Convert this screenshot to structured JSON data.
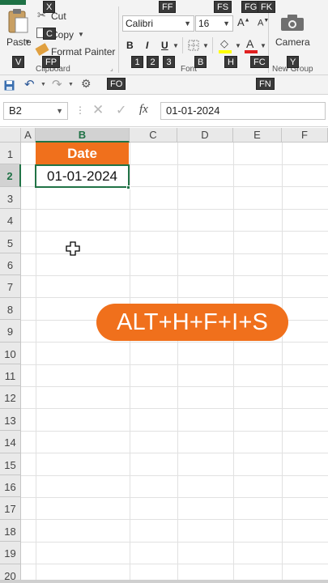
{
  "ribbon": {
    "clipboard": {
      "paste_label": "Paste",
      "cut_label": "Cut",
      "copy_label": "Copy",
      "format_painter_label": "Format Painter",
      "group_label": "Clipboard"
    },
    "font": {
      "font_name": "Calibri",
      "font_size": "16",
      "bold": "B",
      "italic": "I",
      "underline": "U",
      "group_label": "Font"
    },
    "new_group": {
      "camera_label": "Camera",
      "group_label": "New Group"
    },
    "keytips": {
      "x": "X",
      "c": "C",
      "v": "V",
      "fp": "FP",
      "ff": "FF",
      "fs": "FS",
      "fg": "FG",
      "fk": "FK",
      "one": "1",
      "two": "2",
      "three": "3",
      "b": "B",
      "h": "H",
      "fc": "FC",
      "y": "Y",
      "fo": "FO",
      "fn": "FN"
    }
  },
  "formula_bar": {
    "name_box": "B2",
    "fx": "fx",
    "value": "01-01-2024"
  },
  "grid": {
    "columns": [
      "A",
      "B",
      "C",
      "D",
      "E",
      "F"
    ],
    "rows": [
      "1",
      "2",
      "3",
      "4",
      "5",
      "6",
      "7",
      "8",
      "9",
      "10",
      "11",
      "12",
      "13",
      "14",
      "15",
      "16",
      "17",
      "18",
      "19",
      "20"
    ],
    "cells": {
      "B1": "Date",
      "B2": "01-01-2024"
    }
  },
  "overlay": {
    "shortcut": "ALT+H+F+I+S"
  },
  "colors": {
    "accent_orange": "#f0701c",
    "excel_green": "#217346"
  },
  "icons": [
    "paste-icon",
    "cut-icon",
    "copy-icon",
    "format-painter-icon",
    "borders-icon",
    "fill-color-icon",
    "font-color-icon",
    "camera-icon",
    "save-icon",
    "undo-icon",
    "redo-icon",
    "customize-qat-icon",
    "cancel-icon",
    "enter-icon",
    "cross-cursor-icon"
  ]
}
